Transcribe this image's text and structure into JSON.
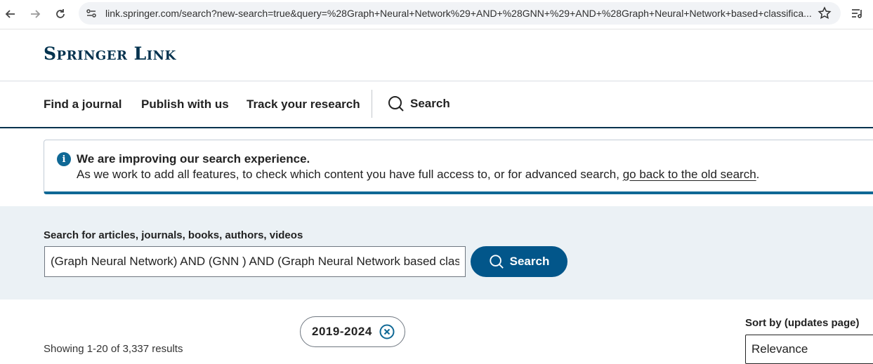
{
  "browser": {
    "url": "link.springer.com/search?new-search=true&query=%28Graph+Neural+Network%29+AND+%28GNN+%29+AND+%28Graph+Neural+Network+based+classifica...",
    "icons": [
      "back-arrow-icon",
      "forward-arrow-icon",
      "reload-icon",
      "site-settings-icon",
      "bookmark-star-icon",
      "reading-list-icon"
    ]
  },
  "header": {
    "logo": "Springer Link"
  },
  "nav": {
    "find_journal": "Find a journal",
    "publish": "Publish with us",
    "track": "Track your research",
    "search": "Search"
  },
  "notice": {
    "title": "We are improving our search experience.",
    "body_prefix": "As we work to add all features, to check which content you have full access to, or for advanced search,",
    "link": "go back to the old search",
    "body_suffix": "."
  },
  "search": {
    "label": "Search for articles, journals, books, authors, videos",
    "query": "(Graph Neural Network) AND (GNN ) AND (Graph Neural Network based classification)",
    "button": "Search"
  },
  "results": {
    "filter_chip": "2019-2024",
    "count_text": "Showing 1-20 of 3,337 results",
    "sort_label": "Sort by (updates page)",
    "sort_value": "Relevance"
  },
  "colors": {
    "brand_dark": "#02324e",
    "brand_blue": "#02568a",
    "accent": "#0f6895",
    "search_band": "#ebf1f5"
  }
}
